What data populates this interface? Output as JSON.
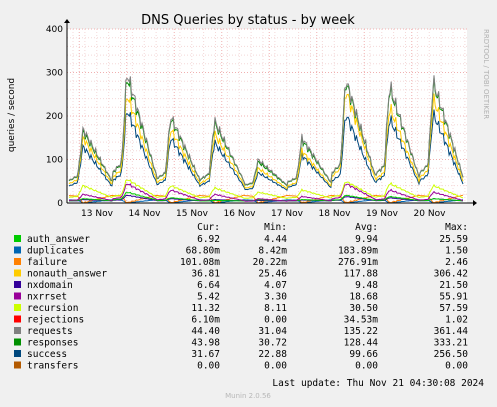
{
  "chart_data": {
    "type": "line",
    "title": "DNS Queries by status - by week",
    "ylabel": "queries / second",
    "xlabel": "",
    "ylim": [
      0,
      400
    ],
    "yticks": [
      0,
      100,
      200,
      300,
      400
    ],
    "categories": [
      "13 Nov",
      "14 Nov",
      "15 Nov",
      "16 Nov",
      "17 Nov",
      "18 Nov",
      "19 Nov",
      "20 Nov"
    ],
    "grid": true,
    "legend_position": "bottom",
    "watermark": "RRDTOOL / TOBI OETIKER",
    "columns": [
      "Cur:",
      "Min:",
      "Avg:",
      "Max:"
    ],
    "series": [
      {
        "name": "auth_answer",
        "color": "#00cc00",
        "cur": "6.92",
        "min": "4.44",
        "avg": "9.94",
        "max": "25.59",
        "peaks": [
          10,
          25,
          12,
          6,
          8,
          8,
          18,
          15,
          10
        ]
      },
      {
        "name": "duplicates",
        "color": "#0066b3",
        "cur": "68.80m",
        "min": "8.42m",
        "avg": "183.89m",
        "max": "1.50",
        "peaks": [
          0.2,
          0.3,
          0.2,
          0.2,
          0.2,
          0.2,
          0.3,
          0.2,
          0.2
        ]
      },
      {
        "name": "failure",
        "color": "#ff8000",
        "cur": "101.08m",
        "min": "20.22m",
        "avg": "276.91m",
        "max": "2.46",
        "peaks": [
          0.3,
          0.4,
          0.3,
          0.3,
          0.3,
          0.3,
          0.4,
          0.3,
          0.3
        ]
      },
      {
        "name": "nonauth_answer",
        "color": "#ffcc00",
        "cur": "36.81",
        "min": "25.46",
        "avg": "117.88",
        "max": "306.42",
        "peaks": [
          150,
          250,
          170,
          160,
          80,
          120,
          260,
          220,
          240
        ]
      },
      {
        "name": "nxdomain",
        "color": "#330099",
        "cur": "6.64",
        "min": "4.07",
        "avg": "9.48",
        "max": "21.50",
        "peaks": [
          8,
          18,
          10,
          8,
          6,
          7,
          15,
          12,
          10
        ]
      },
      {
        "name": "nxrrset",
        "color": "#990099",
        "cur": "5.42",
        "min": "3.30",
        "avg": "18.68",
        "max": "55.91",
        "peaks": [
          20,
          45,
          30,
          20,
          10,
          15,
          45,
          30,
          25
        ]
      },
      {
        "name": "recursion",
        "color": "#ccff00",
        "cur": "11.32",
        "min": "8.11",
        "avg": "30.50",
        "max": "57.59",
        "peaks": [
          40,
          55,
          40,
          35,
          25,
          30,
          50,
          45,
          40
        ]
      },
      {
        "name": "rejections",
        "color": "#ff0000",
        "cur": "6.10m",
        "min": "0.00",
        "avg": "34.53m",
        "max": "1.02",
        "peaks": [
          0,
          0.1,
          0,
          0,
          0,
          0,
          0.1,
          0,
          0
        ]
      },
      {
        "name": "requests",
        "color": "#808080",
        "cur": "44.40",
        "min": "31.04",
        "avg": "135.22",
        "max": "361.44",
        "peaks": [
          170,
          300,
          200,
          190,
          100,
          150,
          285,
          270,
          280
        ]
      },
      {
        "name": "responses",
        "color": "#008f00",
        "cur": "43.98",
        "min": "30.72",
        "avg": "128.44",
        "max": "333.21",
        "peaks": [
          165,
          290,
          195,
          185,
          95,
          145,
          280,
          265,
          275
        ]
      },
      {
        "name": "success",
        "color": "#00487d",
        "cur": "31.67",
        "min": "22.88",
        "avg": "99.66",
        "max": "256.50",
        "peaks": [
          130,
          215,
          150,
          140,
          70,
          110,
          205,
          195,
          205
        ]
      },
      {
        "name": "transfers",
        "color": "#b35a00",
        "cur": "0.00",
        "min": "0.00",
        "avg": "0.00",
        "max": "0.00",
        "peaks": [
          0,
          0,
          0,
          0,
          0,
          0,
          0,
          0,
          0
        ]
      }
    ]
  },
  "footer": {
    "last_update": "Last update: Thu Nov 21 04:30:08 2024",
    "credit": "Munin 2.0.56"
  }
}
